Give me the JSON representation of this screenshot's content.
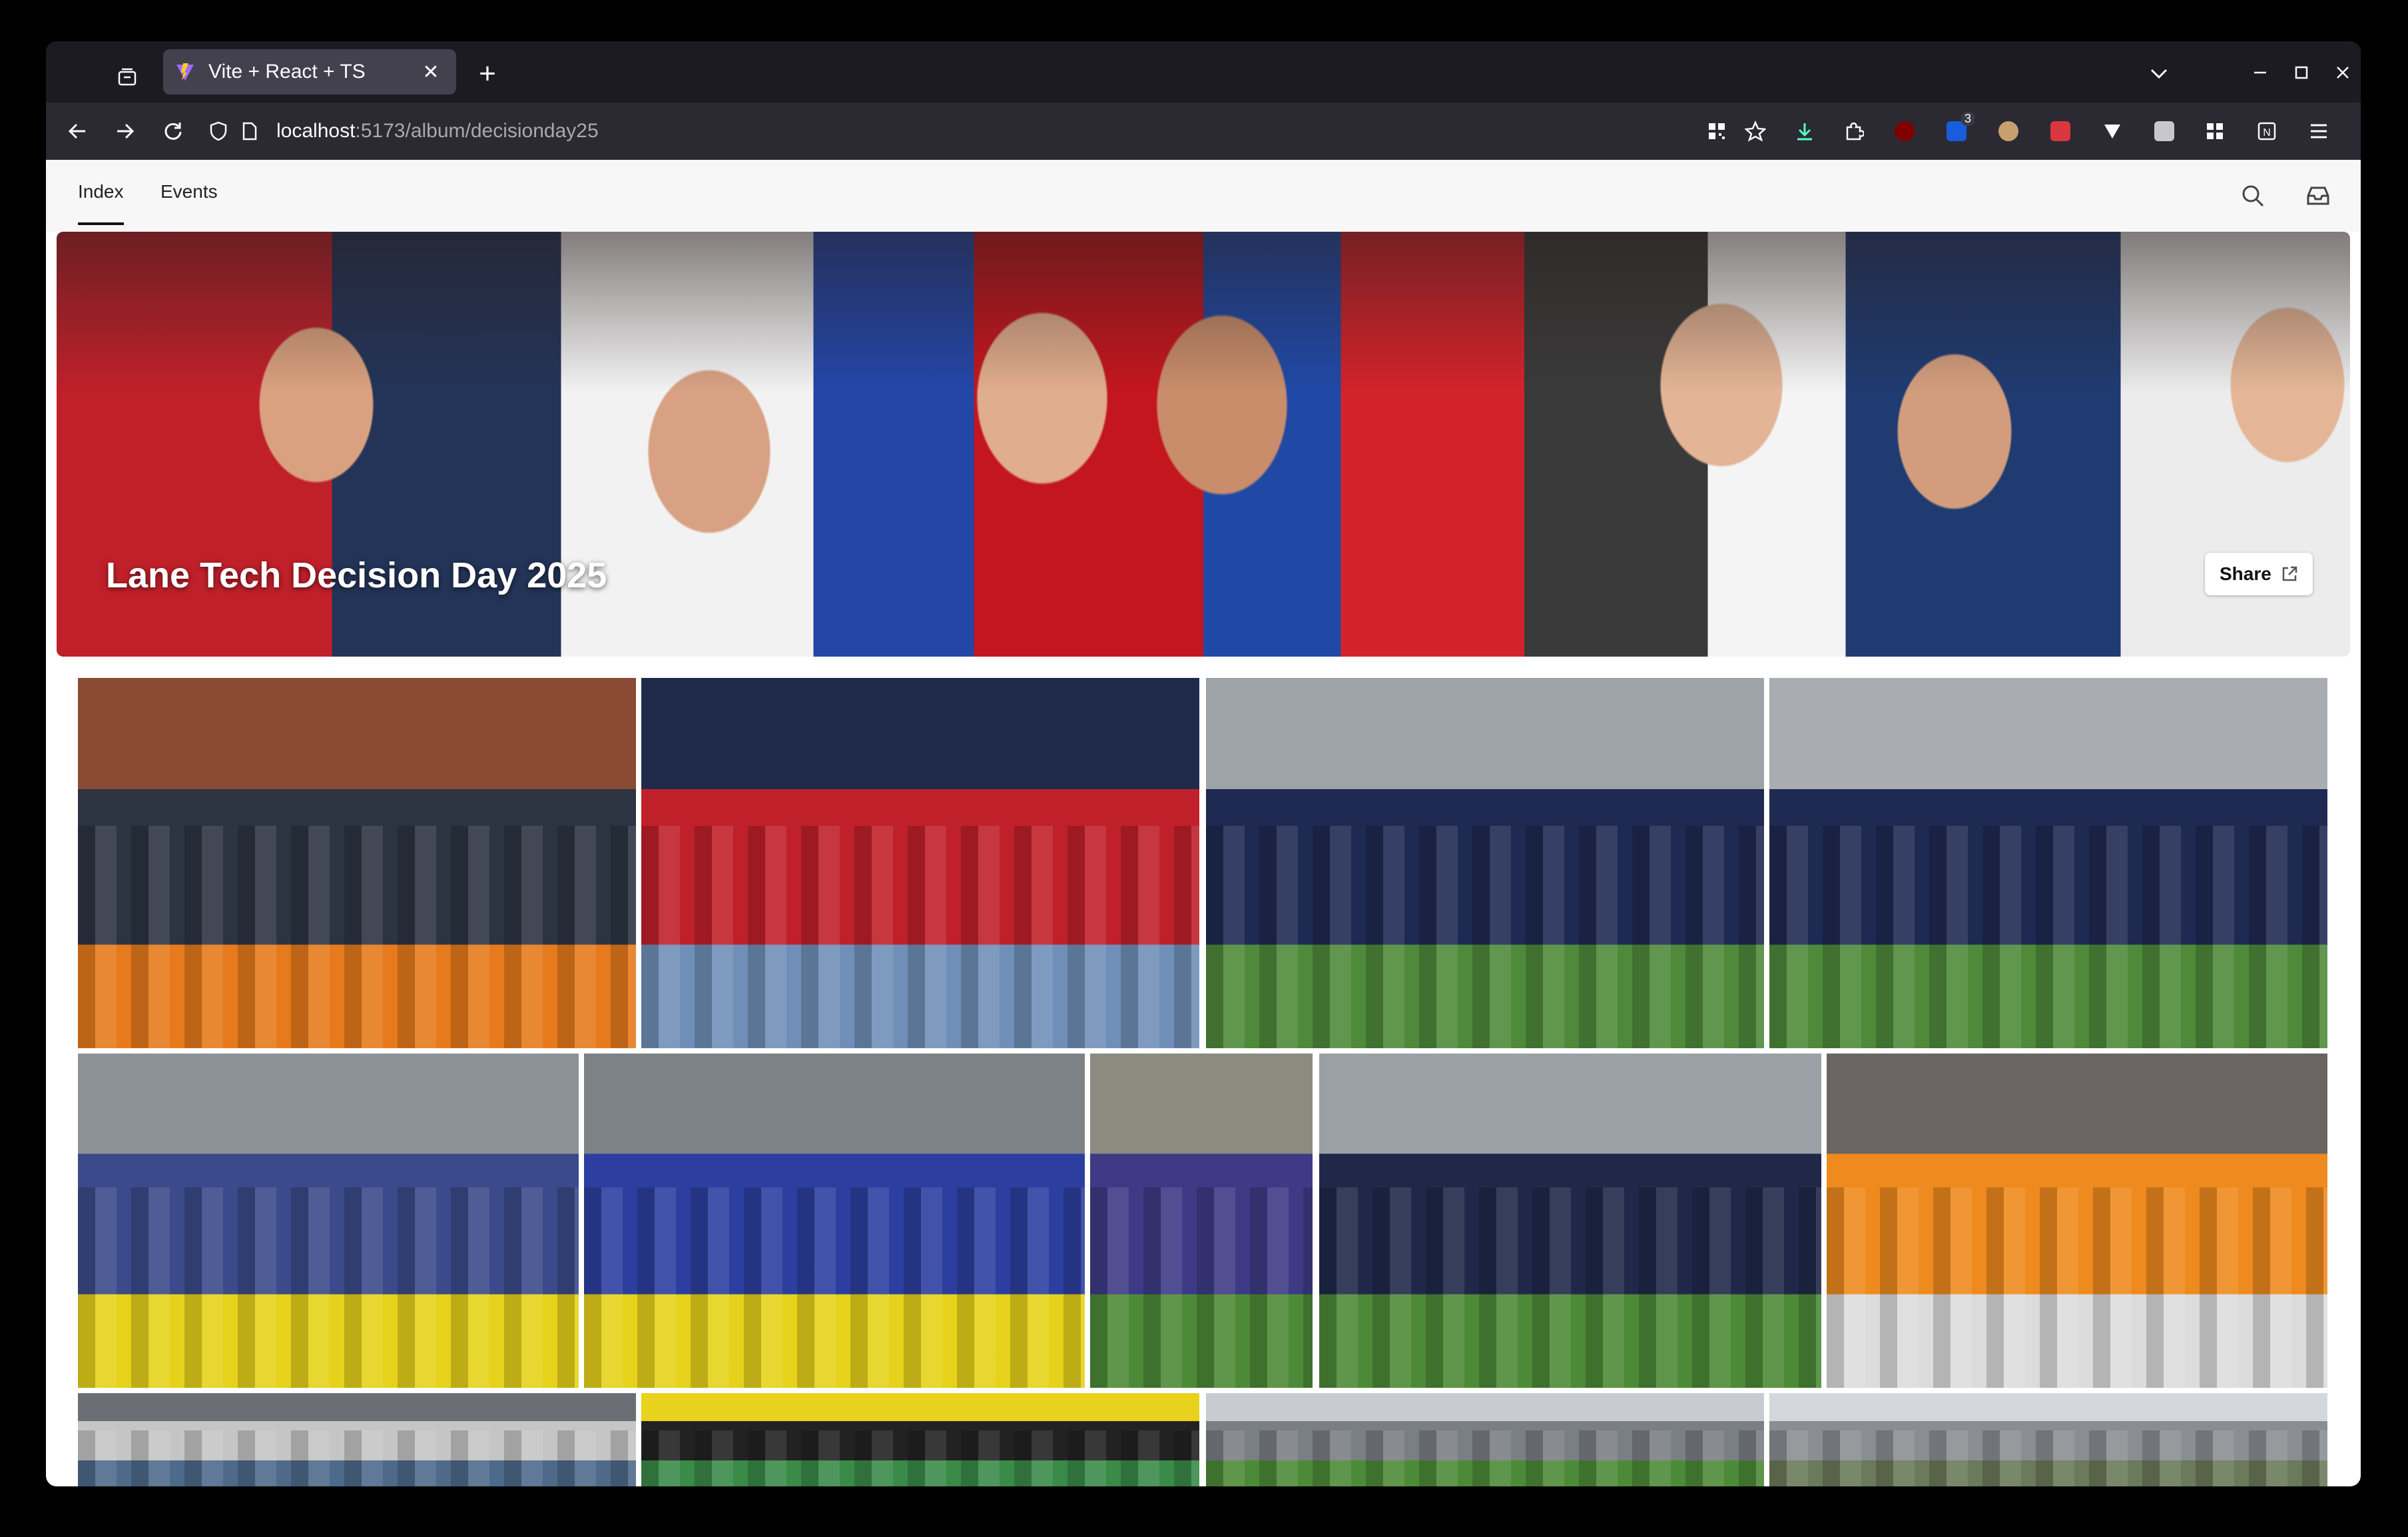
{
  "browser": {
    "tab_title": "Vite + React + TS",
    "url_host": "localhost",
    "url_path": ":5173/album/decisionday25",
    "extension_badge": "3"
  },
  "site": {
    "nav": [
      {
        "label": "Index",
        "active": true
      },
      {
        "label": "Events",
        "active": false
      }
    ]
  },
  "album": {
    "title": "Lane Tech Decision Day 2025",
    "share_label": "Share"
  },
  "photos": [
    {
      "name": "photo-bleachers-crowd",
      "colors": [
        "#8a4a34",
        "#2c3442",
        "#e67a1c"
      ]
    },
    {
      "name": "photo-students-stands",
      "colors": [
        "#1f2a4a",
        "#c0202a",
        "#6f8fb8"
      ]
    },
    {
      "name": "photo-girls-field",
      "colors": [
        "#9ea3a8",
        "#1f2a52",
        "#4e8a3a"
      ]
    },
    {
      "name": "photo-girls-closeup",
      "colors": [
        "#a9adb1",
        "#1f2a52",
        "#4e8a3a"
      ]
    },
    {
      "name": "photo-inflatable-flip",
      "colors": [
        "#8d9296",
        "#3b4a8a",
        "#e6d21a"
      ]
    },
    {
      "name": "photo-inflatable-jump",
      "colors": [
        "#7d8286",
        "#2c3fa0",
        "#e6d21a"
      ]
    },
    {
      "name": "photo-sack-race",
      "colors": [
        "#8b8b80",
        "#3e3a86",
        "#4d8a38"
      ]
    },
    {
      "name": "photo-soccer-goal",
      "colors": [
        "#9aa0a6",
        "#20284a",
        "#4d8a38"
      ]
    },
    {
      "name": "photo-tug-of-war",
      "colors": [
        "#6a6462",
        "#ee8a1e",
        "#dcdcdc"
      ]
    },
    {
      "name": "photo-bottom-1",
      "colors": [
        "#6b6f75",
        "#c5c5c5",
        "#4d6a8a"
      ]
    },
    {
      "name": "photo-bottom-2",
      "colors": [
        "#e8d21e",
        "#222222",
        "#3a8a48"
      ]
    },
    {
      "name": "photo-bottom-3",
      "colors": [
        "#c8ccd0",
        "#7a7f84",
        "#4d8a38"
      ]
    },
    {
      "name": "photo-bottom-4",
      "colors": [
        "#d4d8dc",
        "#8a8e92",
        "#6a7a5a"
      ]
    }
  ]
}
